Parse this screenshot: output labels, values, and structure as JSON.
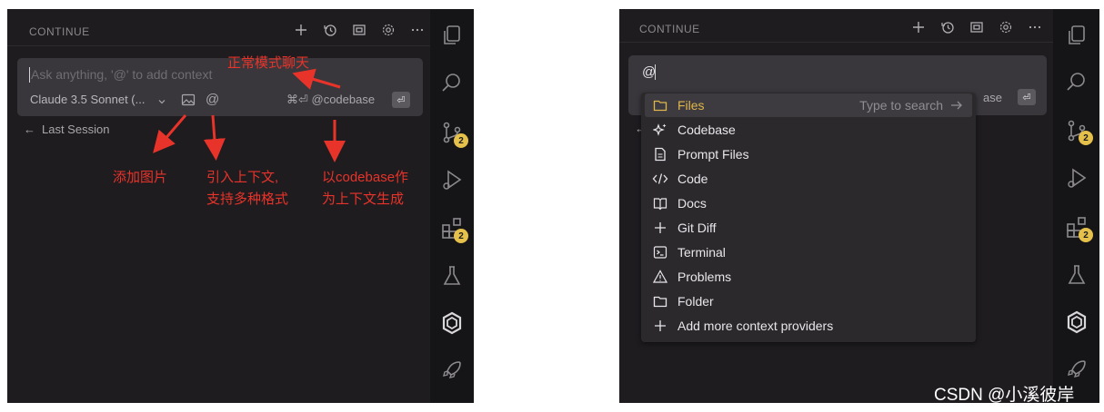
{
  "left_panel": {
    "header": {
      "title": "CONTINUE"
    },
    "input": {
      "placeholder": "Ask anything, '@' to add context",
      "model_label": "Claude 3.5 Sonnet (...",
      "codebase_shortcut": "⌘⏎ @codebase",
      "at_symbol": "@",
      "enter_glyph": "⏎"
    },
    "last_session": {
      "arrow": "←",
      "label": "Last Session"
    },
    "annotations": {
      "normal_chat": "正常模式聊天",
      "add_image": "添加图片",
      "at_context_line1": "引入上下文,",
      "at_context_line2": "支持多种格式",
      "codebase_line1": "以codebase作",
      "codebase_line2": "为上下文生成"
    },
    "activity_badges": [
      "2",
      "2"
    ]
  },
  "right_panel": {
    "header": {
      "title": "CONTINUE"
    },
    "input": {
      "value": "@",
      "codebase_fragment": "ase",
      "enter_glyph": "⏎",
      "left_arrow": "←"
    },
    "dropdown": {
      "search_hint": "Type to search",
      "items": [
        {
          "label": "Files",
          "icon": "folder-icon",
          "selected": true
        },
        {
          "label": "Codebase",
          "icon": "sparkle-icon"
        },
        {
          "label": "Prompt Files",
          "icon": "file-icon"
        },
        {
          "label": "Code",
          "icon": "code-icon"
        },
        {
          "label": "Docs",
          "icon": "book-icon"
        },
        {
          "label": "Git Diff",
          "icon": "plus-icon"
        },
        {
          "label": "Terminal",
          "icon": "terminal-icon"
        },
        {
          "label": "Problems",
          "icon": "warning-icon"
        },
        {
          "label": "Folder",
          "icon": "folder-icon"
        },
        {
          "label": "Add more context providers",
          "icon": "plus-icon"
        }
      ]
    },
    "activity_badges": [
      "2",
      "2"
    ]
  },
  "watermark": "CSDN @小溪彼岸",
  "colors": {
    "annotation": "#e8332a",
    "selected_item": "#e0b64a",
    "badge": "#e5c04a"
  }
}
